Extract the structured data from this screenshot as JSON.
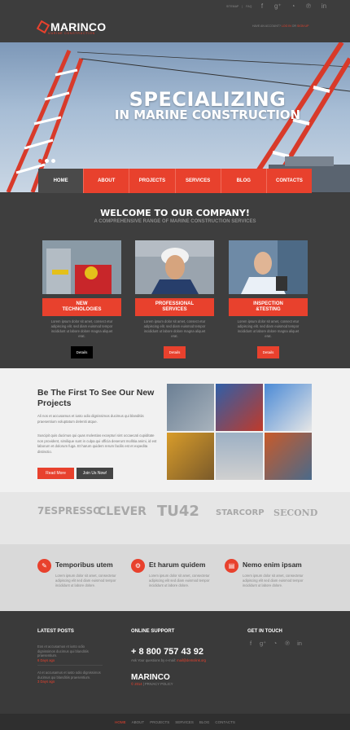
{
  "header": {
    "logo_text": "MARINCO",
    "logo_tag": "MARINE CONSTRUCTION",
    "toplinks": [
      "SITEMAP",
      "|",
      "FAQ"
    ],
    "social_icons": [
      "facebook-icon",
      "google-plus-icon",
      "rss-icon",
      "pinterest-icon",
      "linkedin-icon"
    ],
    "account_prefix": "HAVE AN ACCOUNT?",
    "account_login": "LOG IN",
    "account_or": "OR",
    "account_signup": "SIGN UP"
  },
  "hero": {
    "title_line1": "SPECIALIZING",
    "title_line2": "IN MARINE CONSTRUCTION",
    "dots": 3,
    "active_dot": 0
  },
  "nav": {
    "items": [
      "HOME",
      "ABOUT",
      "PROJECTS",
      "SERVICES",
      "BLOG",
      "CONTACTS"
    ],
    "active": "HOME"
  },
  "welcome": {
    "title": "WELCOME TO OUR COMPANY!",
    "subtitle": "A COMPREHENSIVE RANGE OF MARINE CONSTRUCTION SERVICES",
    "cards": [
      {
        "title1": "NEW",
        "title2": "TECHNOLOGIES",
        "desc": "Lorem ipsum dolor sit amet, consect etur adipiscing elit. sed diam euismod tempor incididunt ut labore dolore magna aliquet erat.",
        "button": "Details",
        "button_color": "#000000"
      },
      {
        "title1": "PROFESSIONAL",
        "title2": "SERVICES",
        "desc": "Lorem ipsum dolor sit amet, consect etur adipiscing elit. sed diam euismod tempor incididunt ut labore dolore magna aliquet erat.",
        "button": "Details",
        "button_color": "#e8412d"
      },
      {
        "title1": "INSPECTION",
        "title2": "&TESTING",
        "desc": "Lorem ipsum dolor sit amet, consect etur adipiscing elit. sed diam euismod tempor incididunt ut labore dolore magna aliquet erat.",
        "button": "Details",
        "button_color": "#e8412d"
      }
    ]
  },
  "projects": {
    "title": "Be The First To See Our New Projects",
    "para1": "Ali nos et accusamus et iusto odio dignissimos ducimus qui blanditiis praesentium voluptatum deleniti atque.",
    "para2": "Suscipit quis ducimus qui quas molestias excepturi sint occaecati cupiditate non provident, similique sunt in culpa qui officia deserunt mollitia animi, id est laborum et dolorum fuga. Et harum quidem rerum facilis est et expedita distinctio.",
    "read_more": "Read More",
    "join_us": "Join Us Now!"
  },
  "clients": [
    "7ESPRESSO",
    "CLEVER",
    "TU42",
    "STARCORP",
    "SECOND"
  ],
  "features": [
    {
      "icon": "wrench-icon",
      "title": "Temporibus utem",
      "text": "Lorem ipsum dolor sit amet, consectetur adipiscing elit sed diam euismod tempor incididunt ut labore dolore."
    },
    {
      "icon": "gear-icon",
      "title": "Et harum quidem",
      "text": "Lorem ipsum dolor sit amet, consectetur adipiscing elit sed diam euismod tempor incididunt ut labore dolore."
    },
    {
      "icon": "document-icon",
      "title": "Nemo enim ipsam",
      "text": "Lorem ipsum dolor sit amet, consectetur adipiscing elit sed diam euismod tempor incididunt ut labore dolore."
    }
  ],
  "footer": {
    "latest_posts_title": "LATEST POSTS",
    "posts": [
      {
        "text": "Eos et accusamus et iusto odio dignissimos ducimus qui blanditiis praesentium.",
        "date": "6 Days ago"
      },
      {
        "text": "At et accusamus et iusto odio dignissimos ducimus qui blanditiis praesentium.",
        "date": "3 Days ago"
      }
    ],
    "online_support_title": "ONLINE SUPPORT",
    "phone": "+ 8 800 757 43 92",
    "phone_sub_prefix": "Ask Your questions by e-mail:",
    "email": "mail@demolink.org",
    "logo": "MARINCO",
    "copyright_year": "© 2014",
    "privacy": "| PRIVACY POLICY",
    "get_in_touch_title": "GET IN TOUCH",
    "bottom_nav": [
      "HOME",
      "ABOUT",
      "PROJECTS",
      "SERVICES",
      "BLOG",
      "CONTACTS"
    ],
    "bottom_active": "HOME"
  },
  "colors": {
    "accent": "#e8412d",
    "dark": "#3a3a3a"
  }
}
